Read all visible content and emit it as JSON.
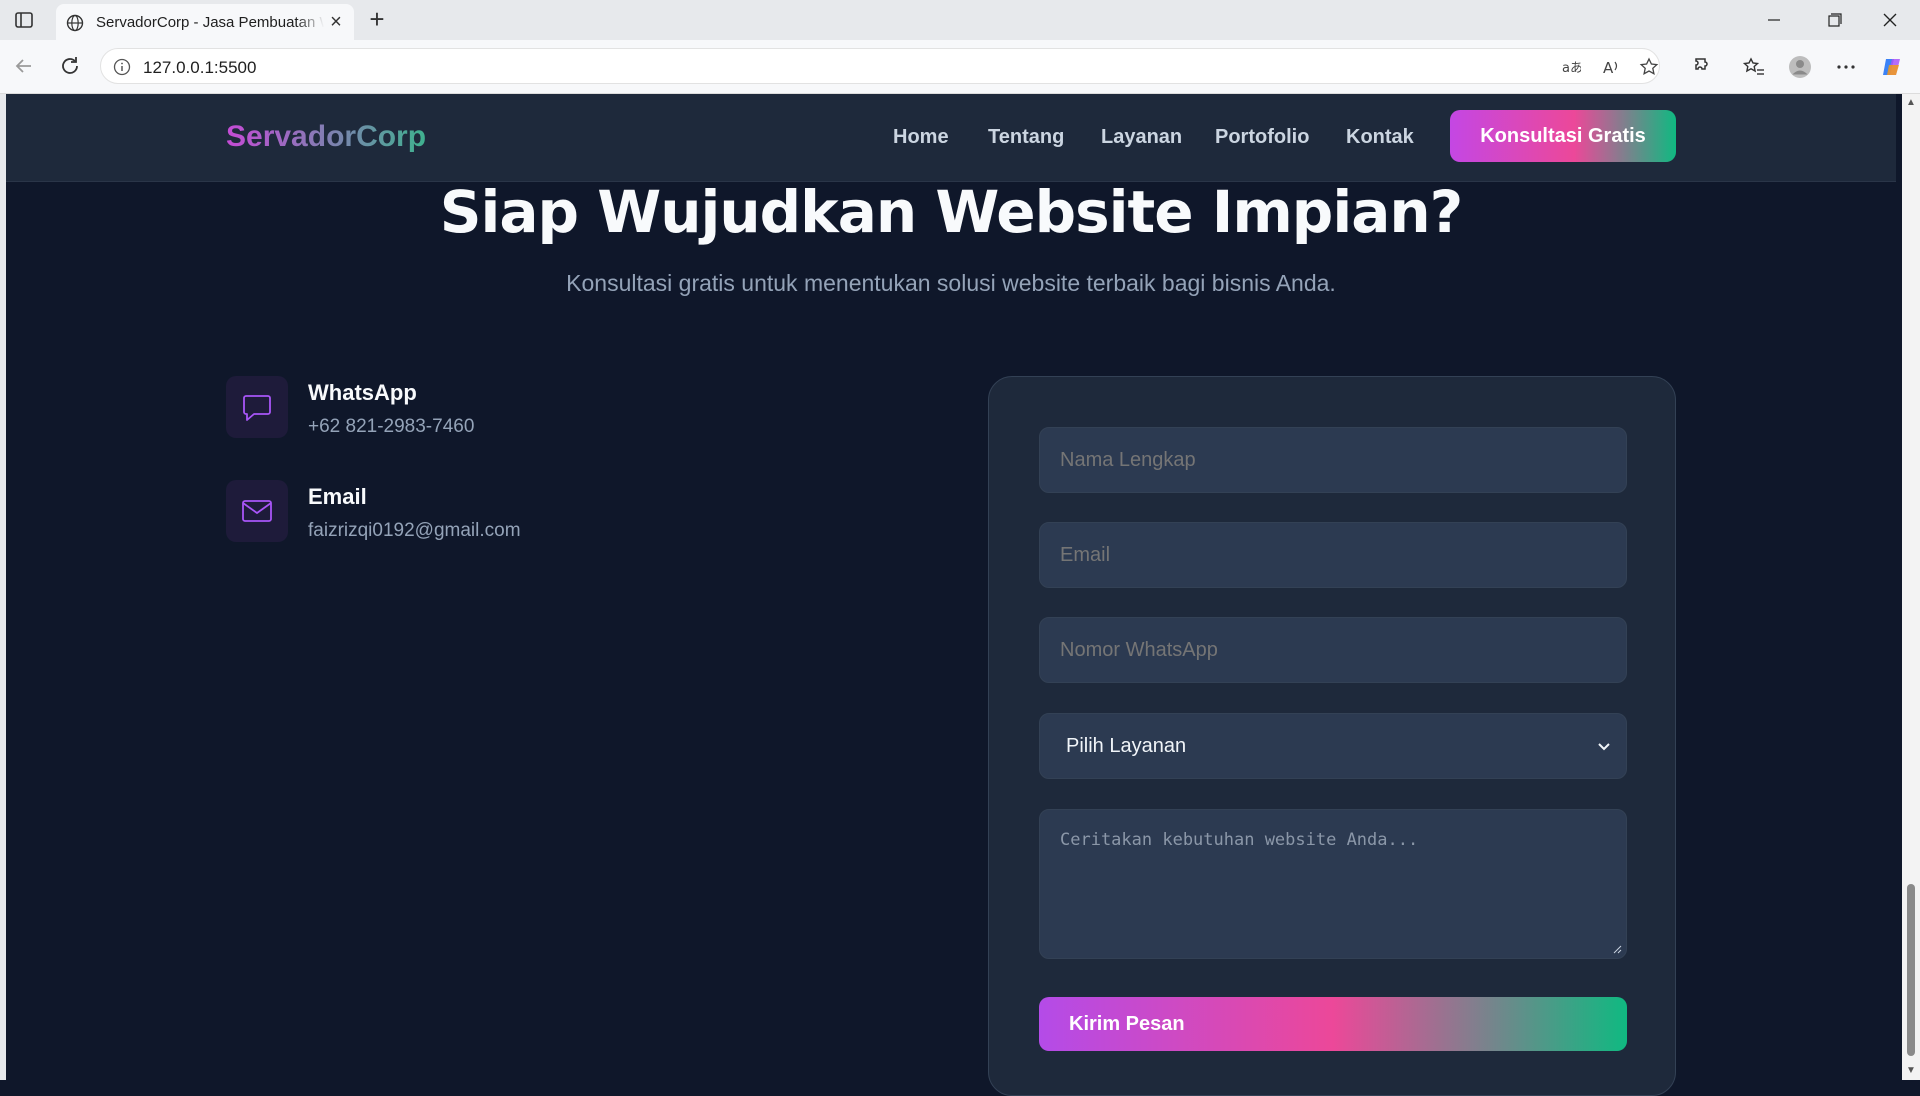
{
  "browser": {
    "tab_title": "ServadorCorp - Jasa Pembuatan Website",
    "url": "127.0.0.1:5500"
  },
  "nav": {
    "logo": "ServadorCorp",
    "links": [
      "Home",
      "Tentang",
      "Layanan",
      "Portofolio",
      "Kontak"
    ],
    "cta": "Konsultasi Gratis"
  },
  "hero": {
    "title": "Siap Wujudkan Website Impian?",
    "subtitle": "Konsultasi gratis untuk menentukan solusi website terbaik bagi bisnis Anda."
  },
  "contacts": [
    {
      "title": "WhatsApp",
      "value": "+62 821-2983-7460",
      "icon": "chat-icon"
    },
    {
      "title": "Email",
      "value": "faizrizqi0192@gmail.com",
      "icon": "mail-icon"
    }
  ],
  "form": {
    "name_placeholder": "Nama Lengkap",
    "email_placeholder": "Email",
    "whatsapp_placeholder": "Nomor WhatsApp",
    "service_selected": "Pilih Layanan",
    "message_placeholder": "Ceritakan kebutuhan website Anda...",
    "submit": "Kirim Pesan"
  },
  "colors": {
    "background": "#0f172a",
    "card": "#1e293b",
    "accent_purple": "#c447e4",
    "accent_pink": "#ec4899",
    "accent_green": "#10b981"
  }
}
